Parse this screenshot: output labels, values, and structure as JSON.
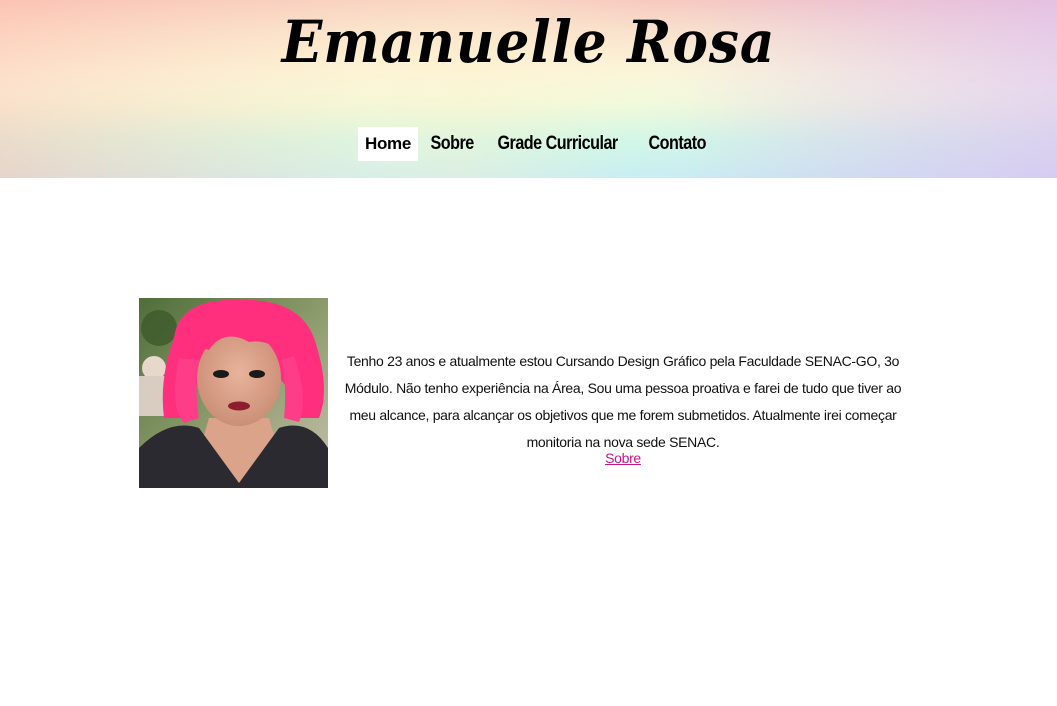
{
  "header": {
    "site_title": "Emanuelle Rosa"
  },
  "nav": {
    "items": [
      {
        "label": "Home",
        "active": true
      },
      {
        "label": "Sobre",
        "active": false
      },
      {
        "label": "Grade Curricular",
        "active": false
      },
      {
        "label": "Contato",
        "active": false
      }
    ]
  },
  "main": {
    "photo_icon": "profile-photo",
    "intro_text": "Tenho 23 anos e atualmente estou Cursando Design Gráfico pela Faculdade SENAC-GO, 3o Módulo. Não tenho experiência na Área, Sou uma pessoa proativa e farei de tudo que tiver ao meu alcance, para alcançar os objetivos que me forem submetidos. Atualmente irei começar monitoria na nova sede SENAC.",
    "more_link": "Sobre"
  },
  "colors": {
    "link": "#c0188c",
    "hair": "#ff2f7e"
  }
}
